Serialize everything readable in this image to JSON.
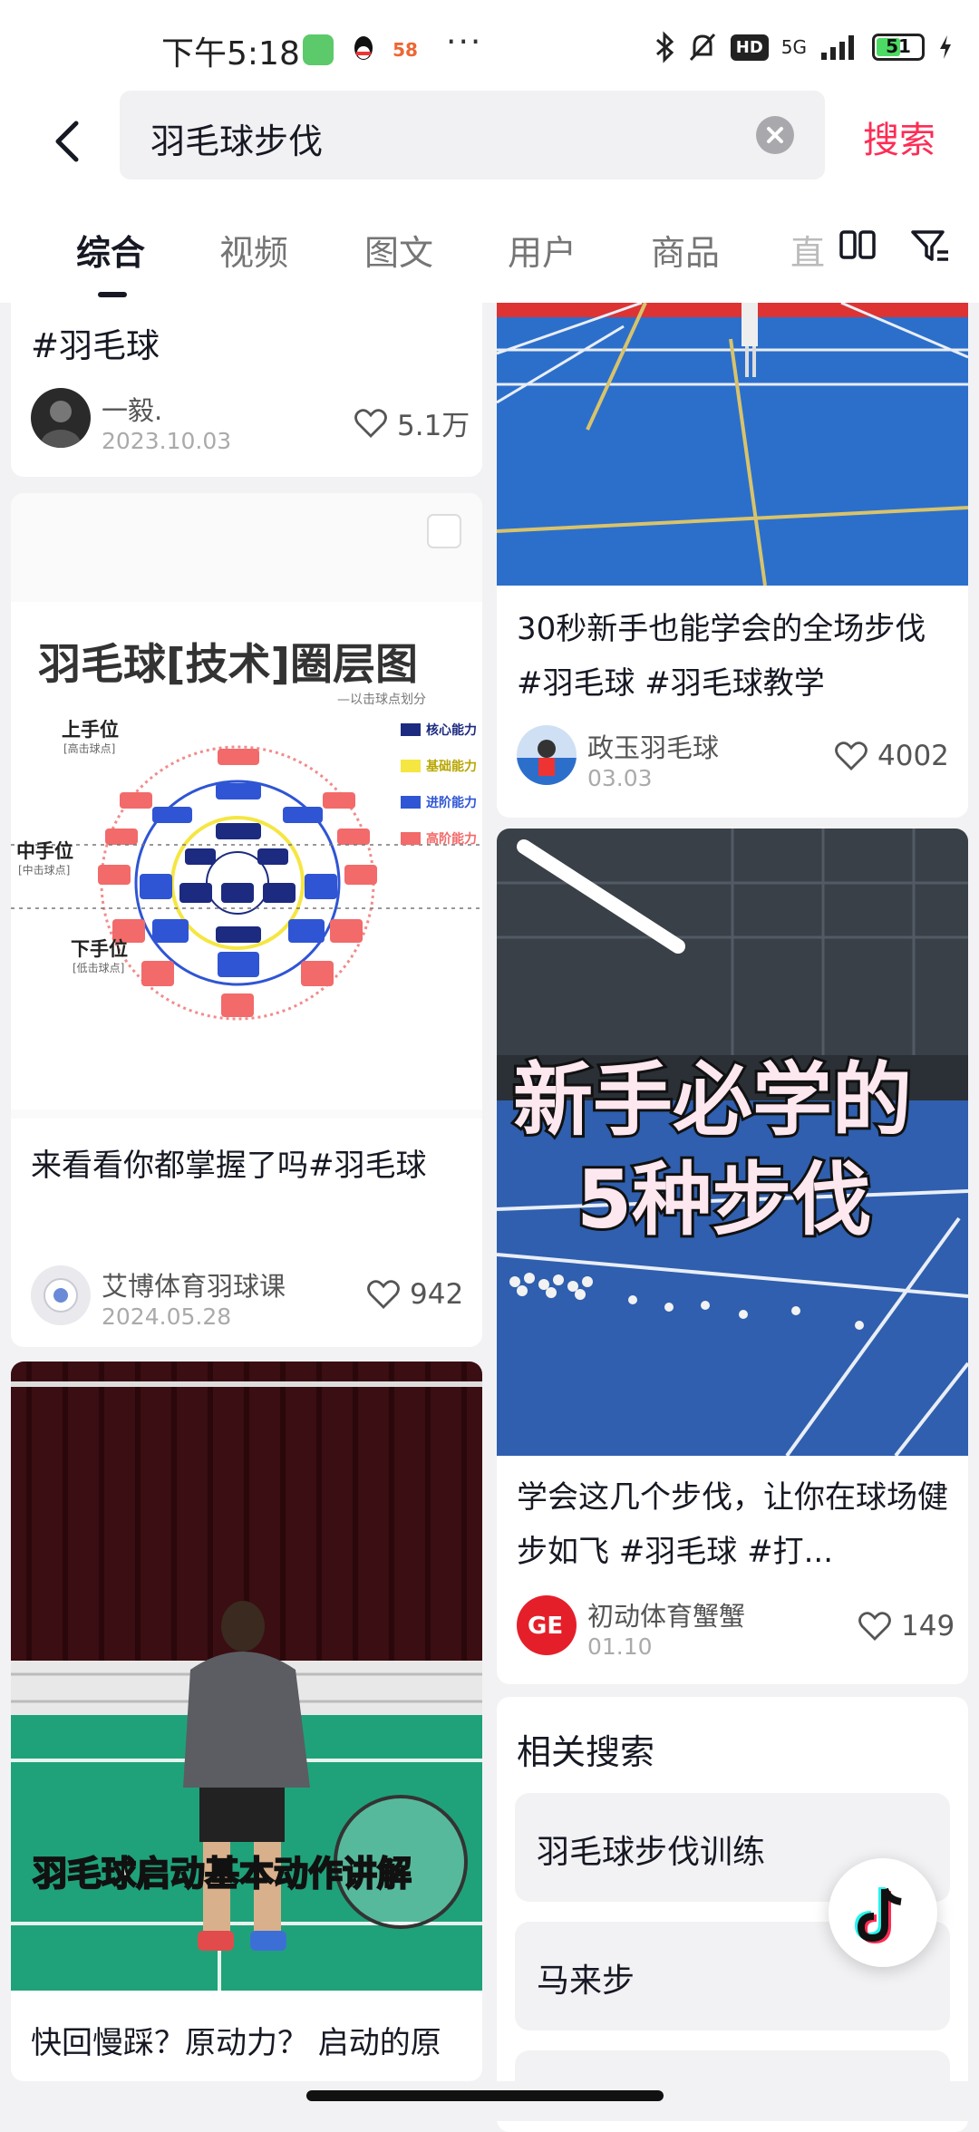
{
  "status_bar": {
    "time": "下午5:18",
    "app_badge_58": "58",
    "more": "···",
    "hd": "HD",
    "network": "5G",
    "battery": "51"
  },
  "search": {
    "query": "羽毛球步伐",
    "submit_label": "搜索"
  },
  "tabs": [
    {
      "label": "综合",
      "active": true
    },
    {
      "label": "视频"
    },
    {
      "label": "图文"
    },
    {
      "label": "用户"
    },
    {
      "label": "商品"
    },
    {
      "label": "直"
    }
  ],
  "left_column": [
    {
      "title": "#羽毛球",
      "author": "一毅.",
      "date": "2023.10.03",
      "likes": "5.1万"
    },
    {
      "title": "来看看你都掌握了吗#羽毛球",
      "author": "艾博体育羽球课",
      "date": "2024.05.28",
      "likes": "942",
      "diagram": {
        "title": "羽毛球[技术]圈层图",
        "subtitle": "—以击球点划分",
        "upper": "上手位",
        "upper_sub": "[高击球点]",
        "middle": "中手位",
        "middle_sub": "[中击球点]",
        "lower": "下手位",
        "lower_sub": "[低击球点]",
        "legend": [
          "核心能力",
          "基础能力",
          "进阶能力",
          "高阶能力"
        ],
        "legend_colors": [
          "#1c2a80",
          "#f5e642",
          "#2f55d4",
          "#f26a6a"
        ]
      }
    },
    {
      "title": "快回慢踩？原动力？ 启动的原理跳诊回归 #羽毛球",
      "video_caption": "羽毛球启动基本动作讲解"
    }
  ],
  "right_column": [
    {
      "title": "30秒新手也能学会的全场步伐 #羽毛球 #羽毛球教学",
      "author": "政玉羽毛球",
      "date": "03.03",
      "likes": "4002"
    },
    {
      "title": "学会这几个步伐，让你在球场健步如飞 #羽毛球 #打...",
      "author": "初动体育蟹蟹",
      "date": "01.10",
      "likes": "149",
      "cover_text_1": "新手必学的",
      "cover_text_2": "5种步伐"
    }
  ],
  "related_search": {
    "title": "相关搜索",
    "items": [
      "羽毛球步伐训练",
      "马来步"
    ]
  },
  "colors": {
    "accent": "#fe2c55",
    "court_blue": "#2c6fcb",
    "court_green": "#1fa27a"
  }
}
